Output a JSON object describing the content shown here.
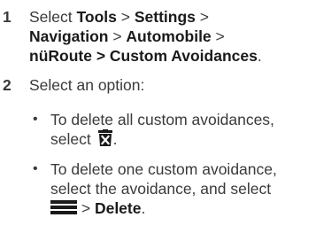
{
  "step1": {
    "number": "1",
    "select": "Select",
    "tools": "Tools",
    "settings": "Settings",
    "navigation": "Navigation",
    "automobile": "Automobile",
    "path_end": "nüRoute > Custom Avoidances",
    "sep": " > ",
    "period": "."
  },
  "step2": {
    "number": "2",
    "text": "Select an option:"
  },
  "bullets": [
    {
      "dot": "•",
      "line1": "To delete all custom avoidances,",
      "line2_pre": "select ",
      "line2_post": ".",
      "icon": "trash-can-x-icon"
    },
    {
      "dot": "•",
      "line1": "To delete one custom avoidance,",
      "line2": "select the avoidance, and select",
      "line3_post": " > ",
      "delete": "Delete",
      "period": ".",
      "icon": "menu-bars-icon"
    }
  ]
}
